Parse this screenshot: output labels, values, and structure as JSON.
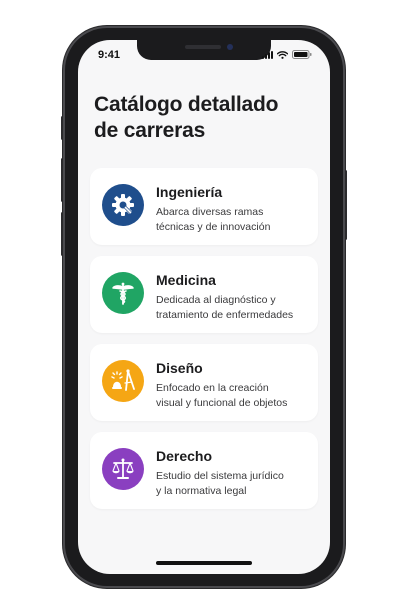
{
  "status_bar": {
    "time": "9:41",
    "icons": [
      "cellular-signal-icon",
      "wifi-icon",
      "battery-icon"
    ]
  },
  "header": {
    "title_line1": "Catálogo detallado",
    "title_line2": "de carreras"
  },
  "careers": [
    {
      "name": "Ingeniería",
      "description_line1": "Abarca diversas ramas",
      "description_line2": "técnicas y de innovación",
      "icon": "gear-icon",
      "color": "#1f4e8c"
    },
    {
      "name": "Medicina",
      "description_line1": "Dedicada al diagnóstico y",
      "description_line2": "tratamiento de enfermedades",
      "icon": "caduceus-icon",
      "color": "#20a564"
    },
    {
      "name": "Diseño",
      "description_line1": "Enfocado en la creación",
      "description_line2": "visual y funcional de objetos",
      "icon": "design-tools-icon",
      "color": "#f5a614"
    },
    {
      "name": "Derecho",
      "description_line1": "Estudio del sistema jurídico",
      "description_line2": "y la normativa legal",
      "icon": "scales-of-justice-icon",
      "color": "#8a3fc0"
    }
  ]
}
